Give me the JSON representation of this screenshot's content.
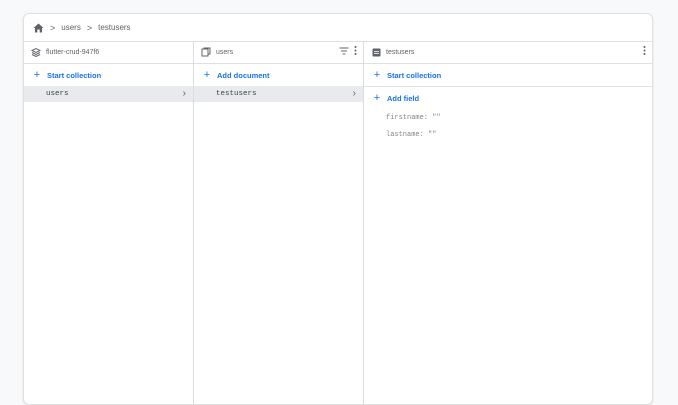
{
  "breadcrumb": {
    "home_icon": "home-icon",
    "separator": ">",
    "items": [
      "users",
      "testusers"
    ]
  },
  "panels": {
    "project": {
      "icon": "database-stack-icon",
      "title": "flutter-crud-947f6",
      "action_label": "Start collection",
      "items": [
        "users"
      ]
    },
    "collection": {
      "icon": "collection-docs-icon",
      "title": "users",
      "filter_icon": "filter-icon",
      "menu_icon": "more-vert-icon",
      "action_label": "Add document",
      "items": [
        "testusers"
      ]
    },
    "document": {
      "icon": "document-icon",
      "title": "testusers",
      "menu_icon": "more-vert-icon",
      "start_collection_label": "Start collection",
      "add_field_label": "Add field",
      "fields": [
        {
          "text": "firstname: \"\""
        },
        {
          "text": "lastname: \"\""
        }
      ]
    }
  },
  "colors": {
    "accent": "#1a73e8",
    "selected_row": "#e8eaed",
    "border": "#e0e0e0"
  }
}
